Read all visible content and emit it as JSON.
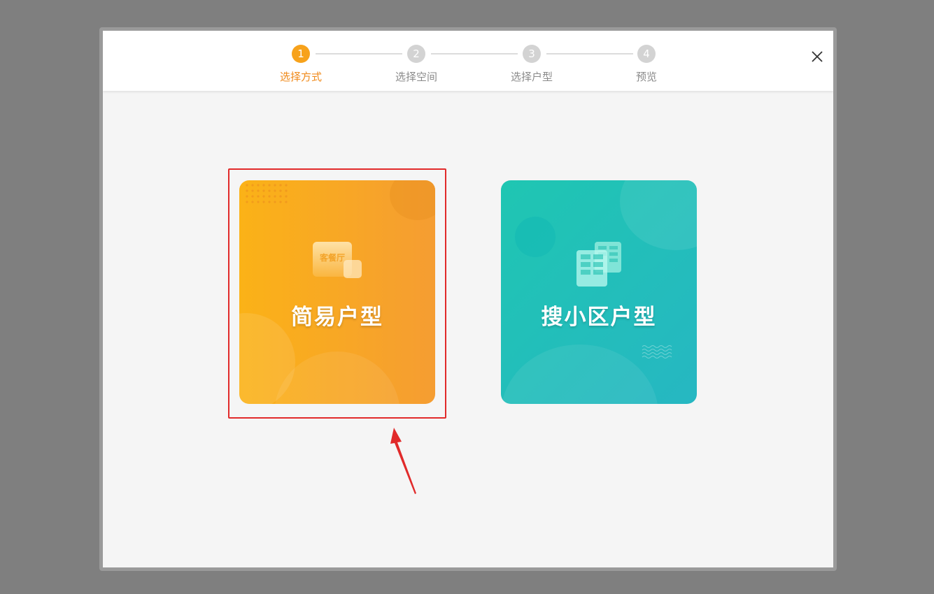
{
  "steps": [
    {
      "number": "1",
      "label": "选择方式",
      "active": true
    },
    {
      "number": "2",
      "label": "选择空间",
      "active": false
    },
    {
      "number": "3",
      "label": "选择户型",
      "active": false
    },
    {
      "number": "4",
      "label": "预览",
      "active": false
    }
  ],
  "cards": {
    "simple": {
      "title": "简易户型",
      "icon_text": "客餐厅",
      "icon": "room-plan-icon"
    },
    "community": {
      "title": "搜小区户型",
      "icon": "buildings-icon"
    }
  },
  "colors": {
    "accent": "#f7a21b",
    "step_active_text": "#f08a1a",
    "step_inactive": "#d3d3d3",
    "card_simple_start": "#fbb217",
    "card_simple_end": "#f59d32",
    "card_community_start": "#1fc6b2",
    "card_community_end": "#26b7c2",
    "annotation": "#e12a2a"
  }
}
